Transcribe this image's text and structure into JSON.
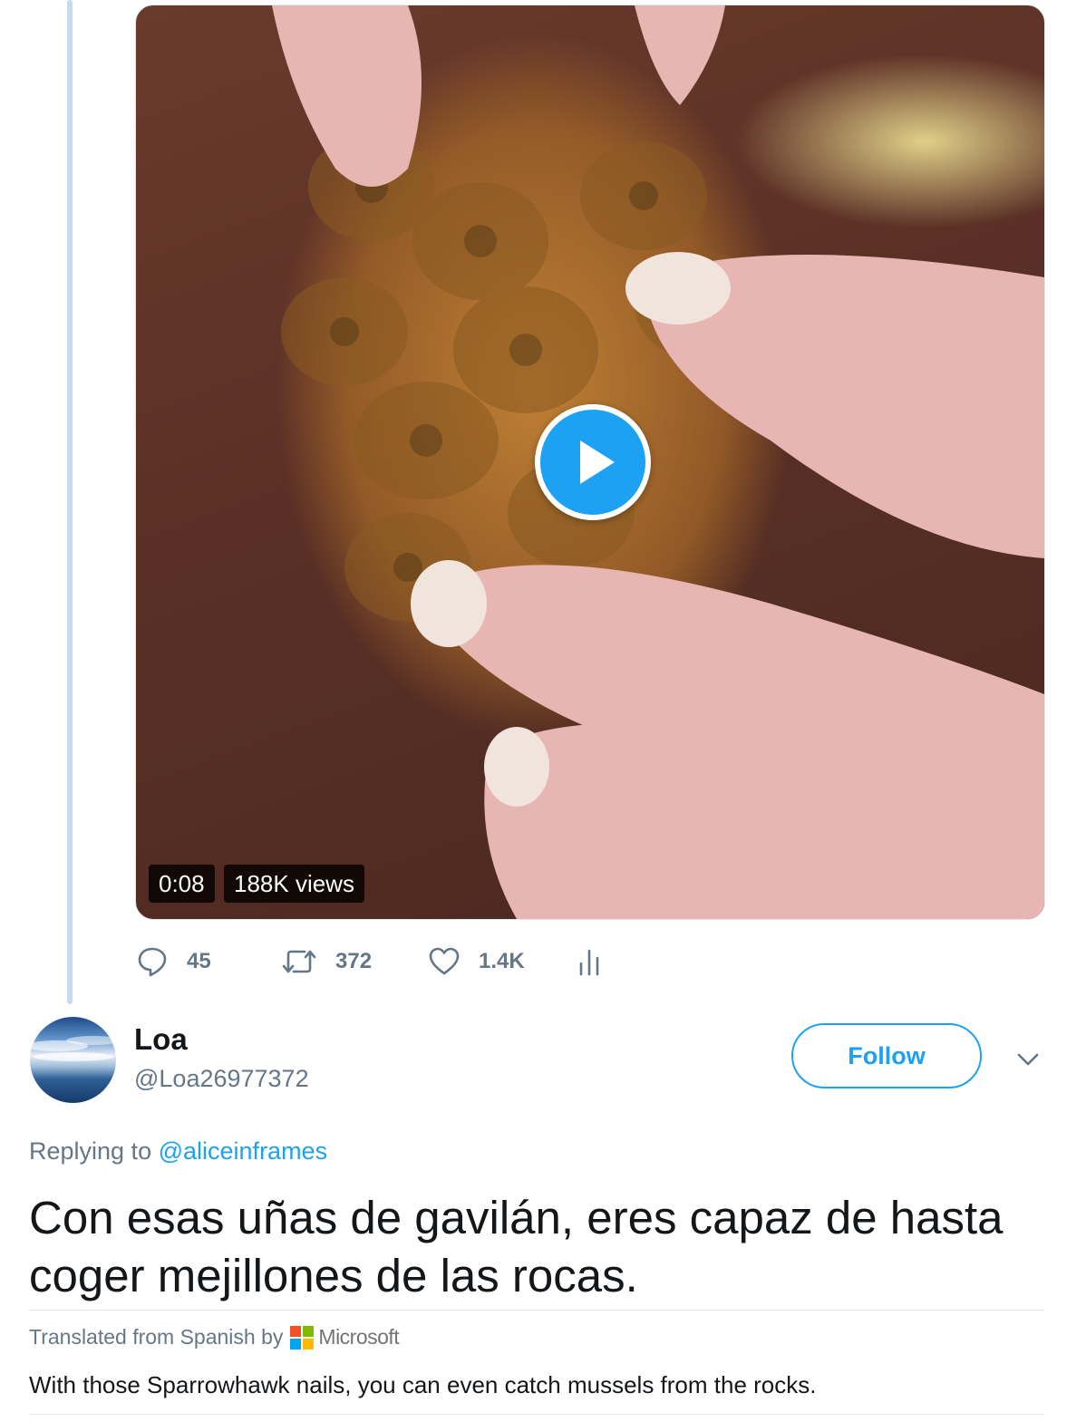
{
  "parent_tweet": {
    "video": {
      "duration": "0:08",
      "views": "188K views"
    },
    "actions": {
      "replies": "45",
      "retweets": "372",
      "likes": "1.4K"
    }
  },
  "reply": {
    "display_name": "Loa",
    "handle": "@Loa26977372",
    "follow_label": "Follow",
    "replying_prefix": "Replying to",
    "replying_to": "@aliceinframes",
    "text": "Con esas uñas de gavilán, eres capaz de hasta coger mejillones de las rocas.",
    "translated_by": "Translated from Spanish by",
    "translator": "Microsoft",
    "translation": "With those Sparrowhawk nails, you can even catch mussels from the rocks."
  },
  "icons": {
    "play": "play-icon",
    "reply": "reply-icon",
    "retweet": "retweet-icon",
    "like": "heart-icon",
    "analytics": "analytics-icon",
    "more": "chevron-down-icon"
  },
  "colors": {
    "accent": "#1da1f2",
    "secondary_text": "#657786",
    "thread_line": "#c4dcf2"
  }
}
